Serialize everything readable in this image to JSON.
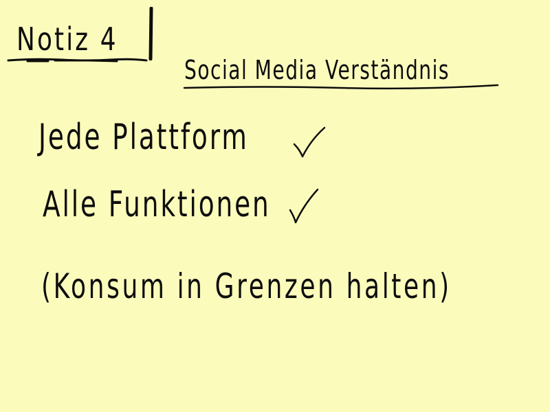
{
  "note": {
    "title": "Notiz 4",
    "heading": "Social Media Verständnis",
    "lines": [
      "Jede Plattform",
      "Alle Funktionen",
      "(Konsum in Grenzen halten)"
    ],
    "check_icon": "check-mark-icon",
    "colors": {
      "background": "#fbfbbc",
      "ink": "#0d0d0d"
    }
  }
}
